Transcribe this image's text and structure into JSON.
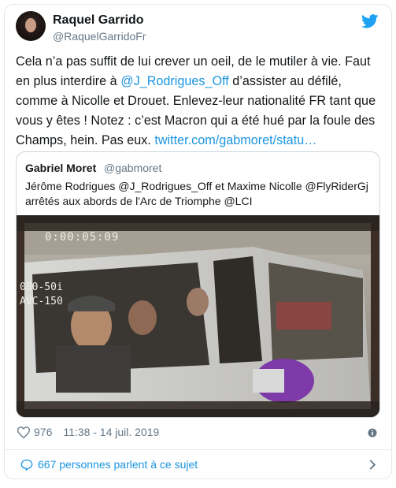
{
  "tweet": {
    "author_name": "Raquel Garrido",
    "author_handle": "@RaquelGarridoFr",
    "text_before": "Cela n’a pas suffit de lui crever un oeil, de le mutiler à vie. Faut en plus interdire à ",
    "mention": "@J_Rodrigues_Off",
    "text_after": " d’assister au défilé, comme à Nicolle et Drouet. Enlevez-leur nationalité FR tant que vous y êtes ! Notez : c’est Macron qui a été hué par la foule des Champs, hein. Pas eux. ",
    "link": "twitter.com/gabmoret/statu…"
  },
  "quoted": {
    "author_name": "Gabriel Moret",
    "author_handle": "@gabmoret",
    "text": "Jérôme Rodrigues @J_Rodrigues_Off et Maxime Nicolle @FlyRiderGj arrêtés aux abords de l'Arc de Triomphe @LCI",
    "media_overlay": {
      "timecode": "0:00:05:09",
      "tag1": "080-50i",
      "tag2": "AVC-150"
    }
  },
  "footer": {
    "likes": "976",
    "timestamp": "11:38 - 14 juil. 2019",
    "conversation": "667 personnes parlent à ce sujet"
  },
  "icons": {
    "bird": "twitter-bird-icon",
    "heart": "heart-icon",
    "info": "info-icon",
    "bubble": "speech-bubble-icon",
    "chevron": "chevron-right-icon"
  },
  "colors": {
    "brand": "#1da1f2",
    "link": "#1b95e0",
    "muted": "#657786",
    "text": "#14171a"
  }
}
